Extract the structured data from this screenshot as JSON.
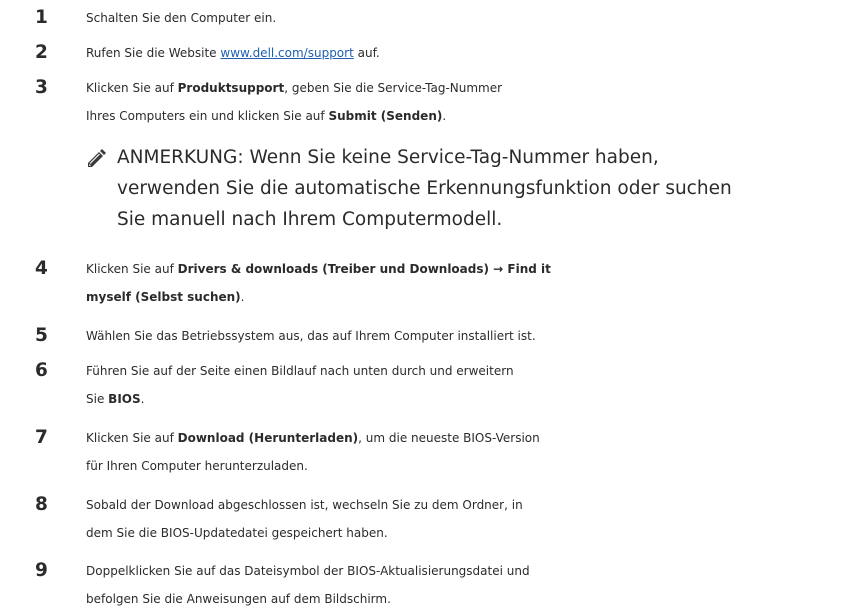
{
  "steps": [
    {
      "number": "1",
      "parts": [
        "Schalten Sie den Computer ein."
      ]
    },
    {
      "number": "2",
      "text_before": "Rufen Sie die Website",
      "link": "www.dell.com/support",
      "text_after": "auf."
    },
    {
      "number": "3",
      "l1_a": "Klicken Sie auf",
      "l1_b": "Produktsupport",
      "l1_c": ", geben Sie die Service-Tag-Nummer",
      "l2_a": "Ihres Computers ein und klicken Sie auf",
      "l2_b": "Submit (Senden)",
      "l2_c": "."
    },
    {
      "number": "4",
      "l1_a": "Klicken Sie auf",
      "l1_b": "Drivers & downloads (Treiber und Downloads) → Find it",
      "l2_b": "myself (Selbst suchen)",
      "l2_c": "."
    },
    {
      "number": "5",
      "text": "Wählen Sie das Betriebssystem aus, das auf Ihrem Computer installiert ist."
    },
    {
      "number": "6",
      "l1": "Führen Sie auf der Seite einen Bildlauf nach unten durch und erweitern",
      "l2_a": "Sie",
      "l2_b": "BIOS",
      "l2_c": "."
    },
    {
      "number": "7",
      "l1_a": "Klicken Sie auf",
      "l1_b": "Download (Herunterladen)",
      "l1_c": ", um die neueste BIOS-Version",
      "l2": "für Ihren Computer herunterzuladen."
    },
    {
      "number": "8",
      "l1": "Sobald der Download abgeschlossen ist, wechseln Sie zu dem Ordner, in",
      "l2": "dem Sie die BIOS-Updatedatei gespeichert haben."
    },
    {
      "number": "9",
      "l1": "Doppelklicken Sie auf das Dateisymbol der BIOS-Aktualisierungsdatei und",
      "l2": "befolgen Sie die Anweisungen auf dem Bildschirm."
    }
  ],
  "note": {
    "icon": "pencil-note-icon",
    "label": "ANMERKUNG:",
    "l1": "Wenn Sie keine Service-Tag-Nummer haben,",
    "l2": "verwenden Sie die automatische Erkennungsfunktion oder suchen",
    "l3": "Sie manuell nach Ihrem Computermodell."
  }
}
